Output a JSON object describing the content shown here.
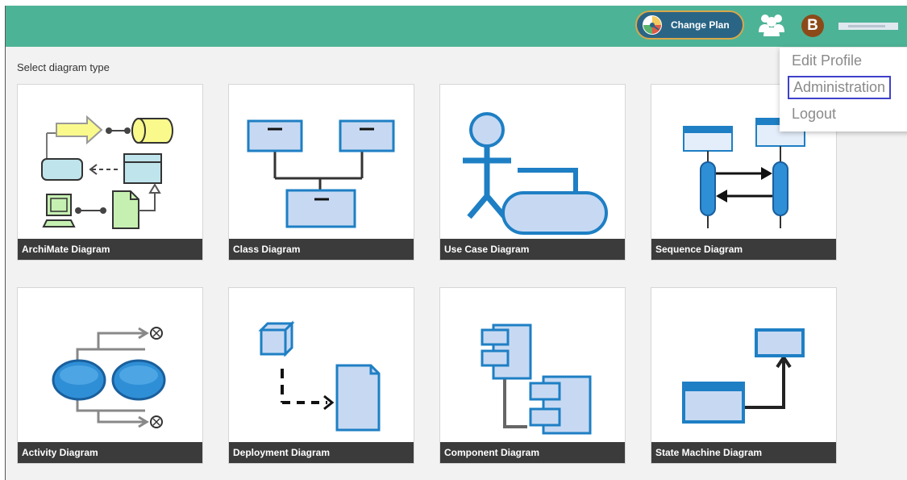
{
  "header": {
    "change_plan_label": "Change Plan",
    "avatar_letter": "B",
    "accent_color": "#4db396"
  },
  "main": {
    "select_label": "Select diagram type",
    "diagrams": [
      {
        "label": "ArchiMate Diagram"
      },
      {
        "label": "Class Diagram"
      },
      {
        "label": "Use Case Diagram"
      },
      {
        "label": "Sequence Diagram"
      },
      {
        "label": "Activity Diagram"
      },
      {
        "label": "Deployment Diagram"
      },
      {
        "label": "Component Diagram"
      },
      {
        "label": "State Machine Diagram"
      }
    ]
  },
  "user_menu": {
    "items": [
      {
        "label": "Edit Profile"
      },
      {
        "label": "Administration"
      },
      {
        "label": "Logout"
      }
    ]
  }
}
